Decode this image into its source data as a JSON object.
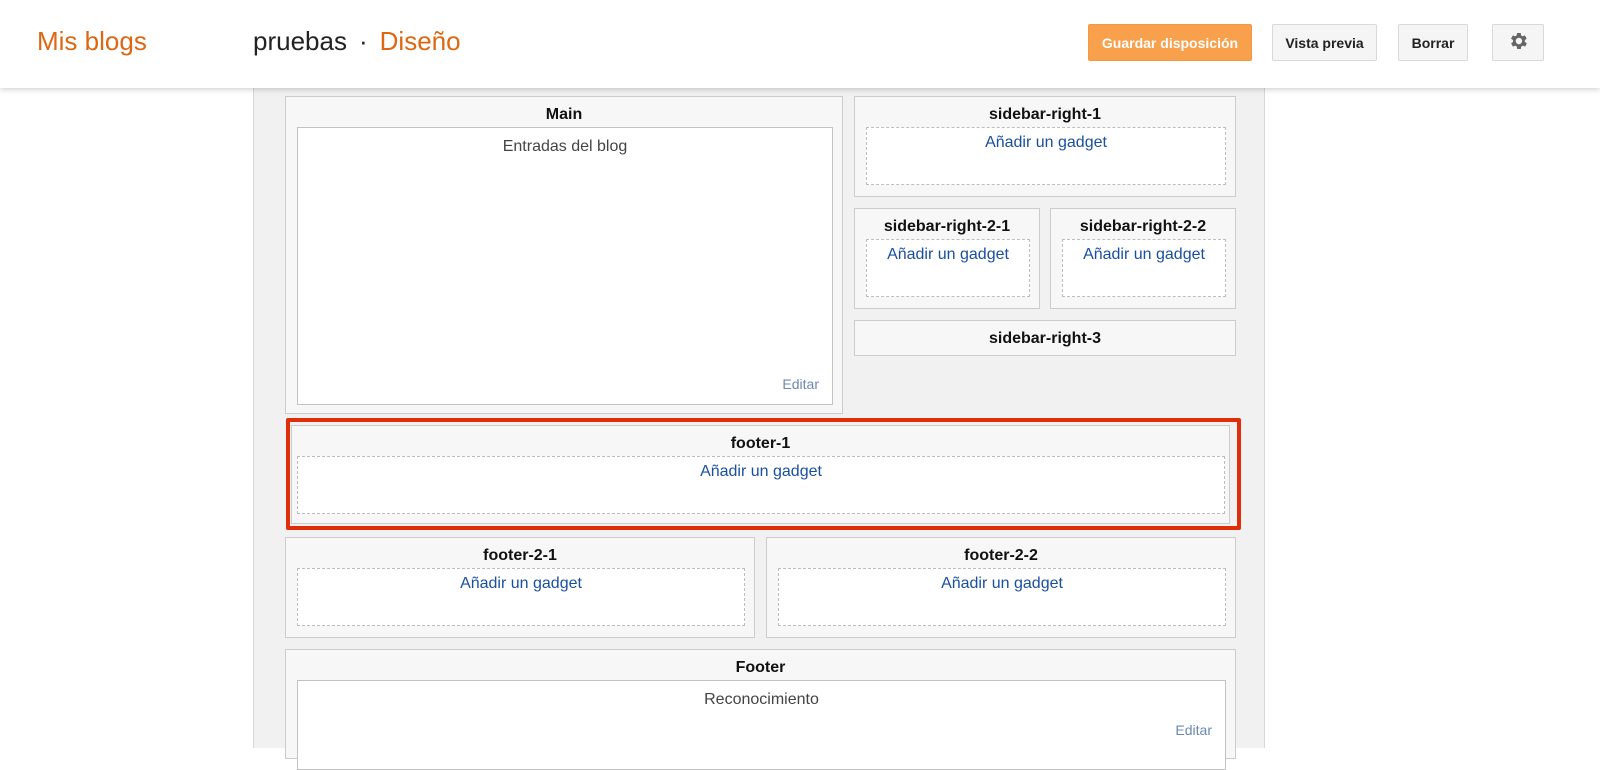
{
  "header": {
    "brand": "Mis blogs",
    "blog_name": "pruebas",
    "separator": "·",
    "section": "Diseño",
    "buttons": {
      "save": "Guardar disposición",
      "preview": "Vista previa",
      "delete": "Borrar"
    },
    "settings_icon": "gear-icon"
  },
  "layout": {
    "main": {
      "title": "Main",
      "gadget": "Entradas del blog",
      "edit": "Editar"
    },
    "sidebar_right_1": {
      "title": "sidebar-right-1",
      "add": "Añadir un gadget"
    },
    "sidebar_right_2_1": {
      "title": "sidebar-right-2-1",
      "add": "Añadir un gadget"
    },
    "sidebar_right_2_2": {
      "title": "sidebar-right-2-2",
      "add": "Añadir un gadget"
    },
    "sidebar_right_3": {
      "title": "sidebar-right-3"
    },
    "footer_1": {
      "title": "footer-1",
      "add": "Añadir un gadget"
    },
    "footer_2_1": {
      "title": "footer-2-1",
      "add": "Añadir un gadget"
    },
    "footer_2_2": {
      "title": "footer-2-2",
      "add": "Añadir un gadget"
    },
    "footer": {
      "title": "Footer",
      "gadget": "Reconocimiento",
      "edit": "Editar"
    }
  },
  "colors": {
    "brand": "#dd6713",
    "primary_button": "#f8a04c",
    "link": "#1a4fa0",
    "highlight": "#e02d0a"
  }
}
